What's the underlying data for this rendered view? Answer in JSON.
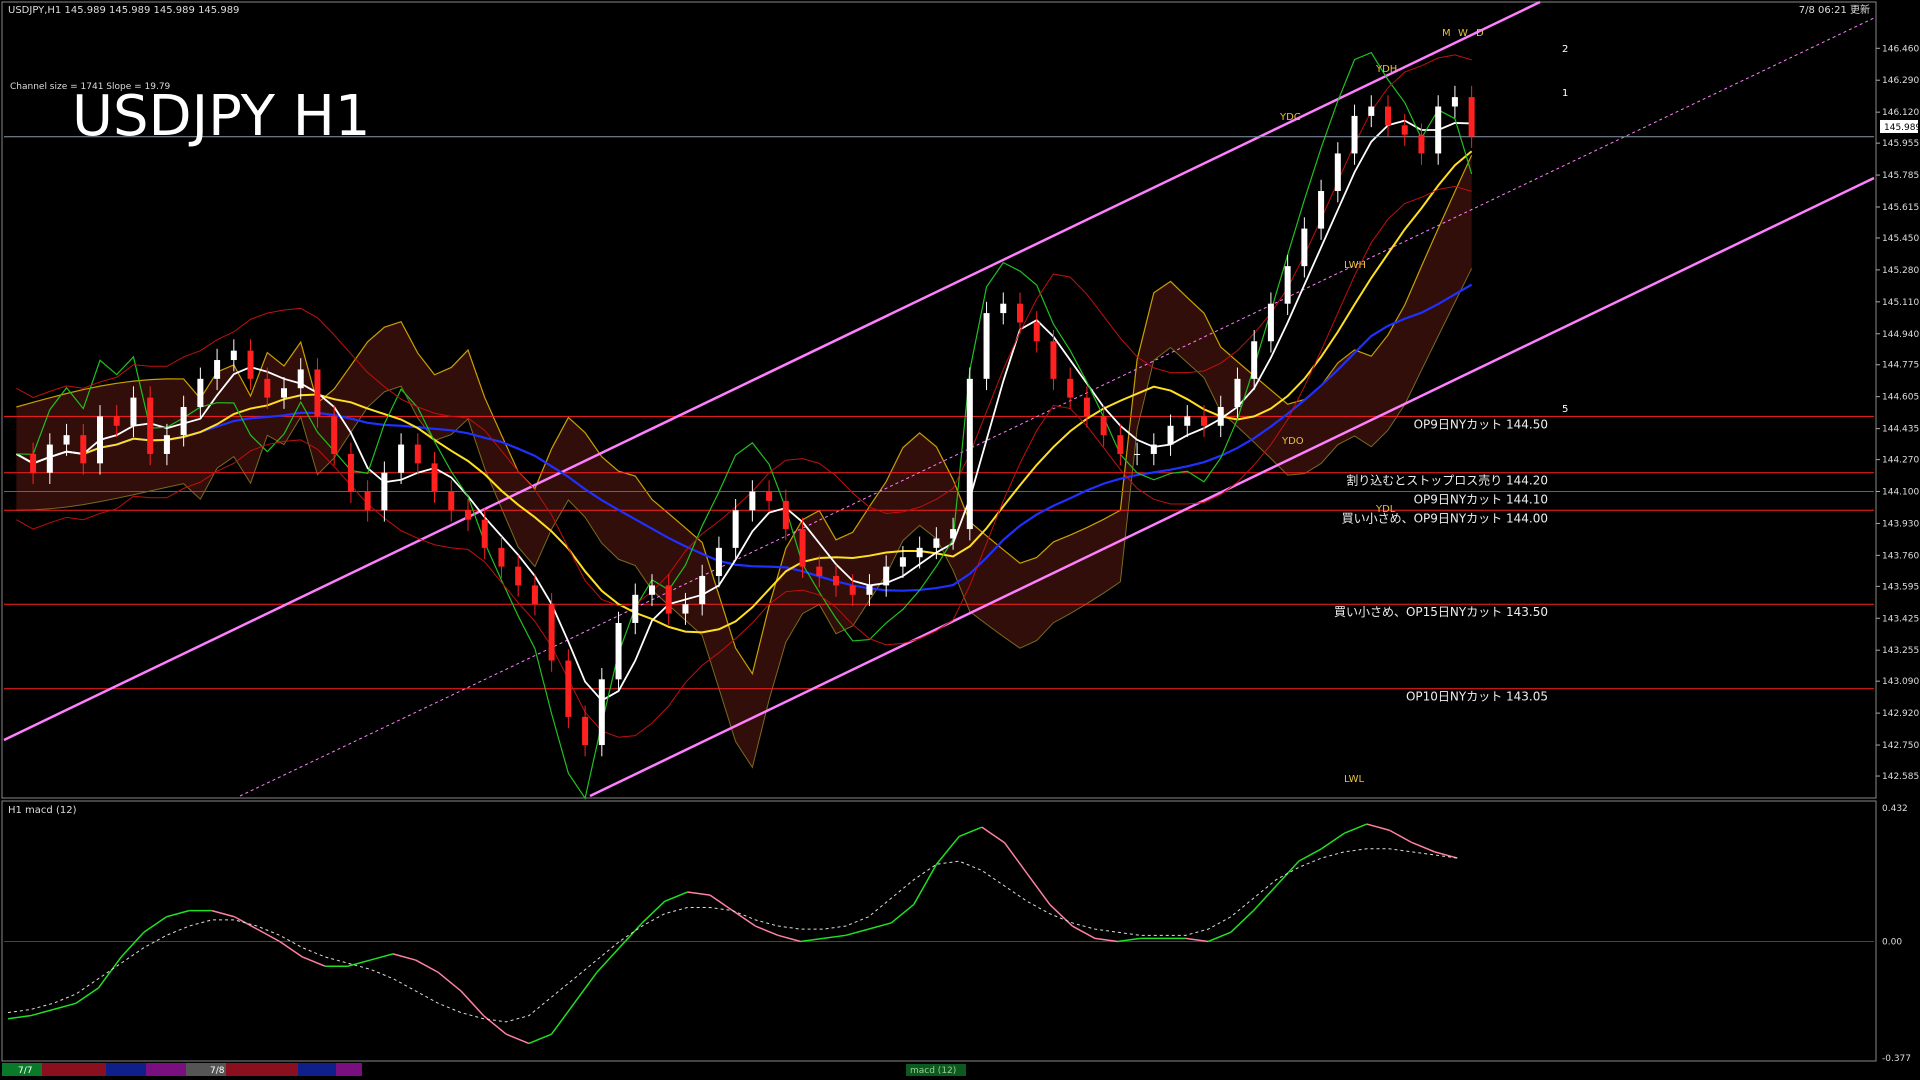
{
  "window": {
    "header": "USDJPY,H1  145.989 145.989 145.989 145.989",
    "timestamp": "7/8 06:21 更新",
    "watermark": "USDJPY H1",
    "channel_info": "Channel size = 1741 Slope = 19.79",
    "current_price": "145.989"
  },
  "chart_data": [
    {
      "type": "candlestick",
      "symbol": "USDJPY",
      "timeframe": "H1",
      "ylim": [
        142.5,
        146.6
      ],
      "y_ticks": [
        "146.460",
        "146.290",
        "146.120",
        "145.955",
        "145.785",
        "145.615",
        "145.450",
        "145.280",
        "145.110",
        "144.940",
        "144.775",
        "144.605",
        "144.435",
        "144.270",
        "144.100",
        "143.930",
        "143.760",
        "143.595",
        "143.425",
        "143.255",
        "143.090",
        "142.920",
        "142.750",
        "142.585"
      ],
      "levels": [
        {
          "price": 144.5,
          "label": "OP9日NYカット 144.50",
          "color": "#ff2020"
        },
        {
          "price": 144.2,
          "label": "割り込むとストップロス売り 144.20",
          "color": "#ff2020"
        },
        {
          "price": 144.1,
          "label": "OP9日NYカット 144.10",
          "color": "#ff2020"
        },
        {
          "price": 144.0,
          "label": "買い小さめ、OP9日NYカット 144.00",
          "color": "#ff2020"
        },
        {
          "price": 143.5,
          "label": "買い小さめ、OP15日NYカット 143.50",
          "color": "#ff2020"
        },
        {
          "price": 143.05,
          "label": "OP10日NYカット 143.05",
          "color": "#ff2020"
        }
      ],
      "close_series": [
        144.3,
        144.2,
        144.35,
        144.4,
        144.25,
        144.5,
        144.45,
        144.6,
        144.3,
        144.4,
        144.55,
        144.7,
        144.8,
        144.85,
        144.7,
        144.6,
        144.65,
        144.75,
        144.5,
        144.3,
        144.1,
        144.0,
        144.2,
        144.35,
        144.25,
        144.1,
        144.0,
        143.95,
        143.8,
        143.7,
        143.6,
        143.5,
        143.2,
        142.9,
        142.75,
        143.1,
        143.4,
        143.55,
        143.6,
        143.45,
        143.5,
        143.65,
        143.8,
        144.0,
        144.1,
        144.05,
        143.9,
        143.7,
        143.65,
        143.6,
        143.55,
        143.6,
        143.7,
        143.75,
        143.8,
        143.85,
        143.9,
        144.7,
        145.05,
        145.1,
        145.0,
        144.9,
        144.7,
        144.6,
        144.5,
        144.4,
        144.3,
        144.3,
        144.35,
        144.45,
        144.5,
        144.45,
        144.55,
        144.7,
        144.9,
        145.1,
        145.3,
        145.5,
        145.7,
        145.9,
        146.1,
        146.15,
        146.05,
        146.0,
        145.9,
        146.15,
        146.2,
        145.99
      ],
      "annotations": [
        "YDH",
        "YDC",
        "YDO",
        "YDL",
        "LWH",
        "LWL",
        "M",
        "W",
        "D",
        "1",
        "2",
        "5"
      ]
    },
    {
      "type": "line",
      "title": "H1  macd (12)",
      "ylim": [
        -0.377,
        0.432
      ],
      "y_ticks": [
        "0.432",
        "0.00",
        "-0.377"
      ],
      "macd": [
        -0.25,
        -0.24,
        -0.22,
        -0.2,
        -0.15,
        -0.05,
        0.03,
        0.08,
        0.1,
        0.1,
        0.08,
        0.04,
        0.0,
        -0.05,
        -0.08,
        -0.08,
        -0.06,
        -0.04,
        -0.06,
        -0.1,
        -0.16,
        -0.24,
        -0.3,
        -0.33,
        -0.3,
        -0.2,
        -0.1,
        -0.02,
        0.06,
        0.13,
        0.16,
        0.15,
        0.1,
        0.05,
        0.02,
        0.0,
        0.01,
        0.02,
        0.04,
        0.06,
        0.12,
        0.25,
        0.34,
        0.37,
        0.32,
        0.22,
        0.12,
        0.05,
        0.01,
        0.0,
        0.01,
        0.01,
        0.01,
        0.0,
        0.03,
        0.1,
        0.18,
        0.26,
        0.3,
        0.35,
        0.38,
        0.36,
        0.32,
        0.29,
        0.27
      ],
      "signal": [
        -0.23,
        -0.22,
        -0.2,
        -0.17,
        -0.12,
        -0.07,
        -0.02,
        0.02,
        0.05,
        0.07,
        0.07,
        0.05,
        0.02,
        -0.02,
        -0.05,
        -0.07,
        -0.09,
        -0.12,
        -0.16,
        -0.2,
        -0.23,
        -0.25,
        -0.26,
        -0.24,
        -0.18,
        -0.12,
        -0.06,
        0.0,
        0.05,
        0.09,
        0.11,
        0.11,
        0.1,
        0.07,
        0.05,
        0.04,
        0.04,
        0.05,
        0.08,
        0.14,
        0.2,
        0.25,
        0.26,
        0.23,
        0.18,
        0.13,
        0.09,
        0.06,
        0.04,
        0.03,
        0.02,
        0.02,
        0.02,
        0.04,
        0.08,
        0.14,
        0.2,
        0.24,
        0.27,
        0.29,
        0.3,
        0.3,
        0.29,
        0.28,
        0.27
      ]
    }
  ],
  "footer": {
    "period_tabs": [
      "7/7",
      "7/8"
    ],
    "macd_button": "macd (12)"
  }
}
